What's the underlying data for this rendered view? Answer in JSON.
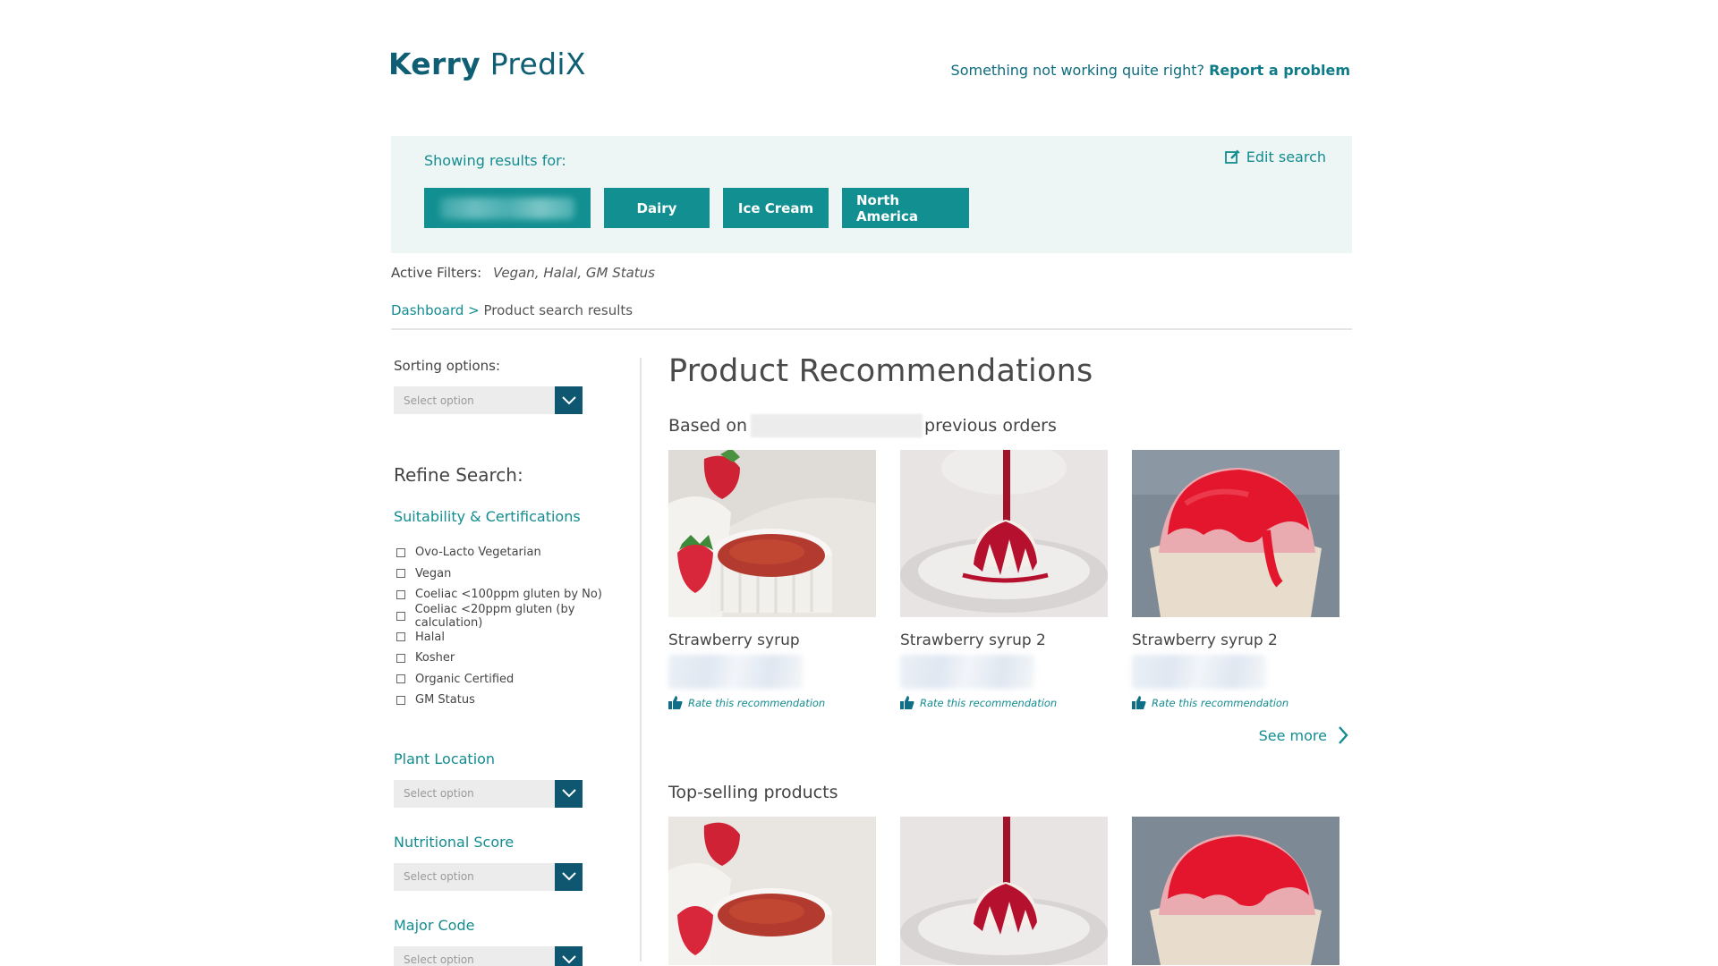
{
  "header": {
    "logo_bold": "Kerry",
    "logo_regular": "PrediX",
    "report_prefix": "Something not working quite right?",
    "report_link": "Report a problem"
  },
  "search_panel": {
    "showing_label": "Showing results for:",
    "edit_label": "Edit search",
    "chips": [
      "Dairy",
      "Ice Cream",
      "North America"
    ]
  },
  "filters": {
    "label": "Active Filters:",
    "values": "Vegan, Halal, GM Status"
  },
  "breadcrumb": {
    "home": "Dashboard >",
    "current": "Product search results"
  },
  "sidebar": {
    "sorting_label": "Sorting options:",
    "select_placeholder": "Select option",
    "refine_title": "Refine Search:",
    "suitability_title": "Suitability & Certifications",
    "checkboxes": [
      "Ovo-Lacto Vegetarian",
      "Vegan",
      "Coeliac <100ppm gluten by No)",
      "Coeliac <20ppm gluten (by calculation)",
      "Halal",
      "Kosher",
      "Organic Certified",
      "GM Status"
    ],
    "plant_location": "Plant Location",
    "nutritional_score": "Nutritional Score",
    "major_code": "Major Code"
  },
  "main": {
    "title": "Product Recommendations",
    "based_on_prefix": "Based on",
    "based_on_suffix": "previous orders",
    "recommendations": [
      {
        "name": "Strawberry syrup",
        "rate": "Rate this recommendation"
      },
      {
        "name": "Strawberry syrup 2",
        "rate": "Rate this recommendation"
      },
      {
        "name": "Strawberry syrup 2",
        "rate": "Rate this recommendation"
      }
    ],
    "see_more": "See more",
    "top_selling_title": "Top-selling products"
  },
  "colors": {
    "brand_dark": "#0e5f73",
    "accent_teal": "#128f91",
    "panel_bg": "#eef6f5",
    "select_arrow_bg": "#0f5670"
  }
}
